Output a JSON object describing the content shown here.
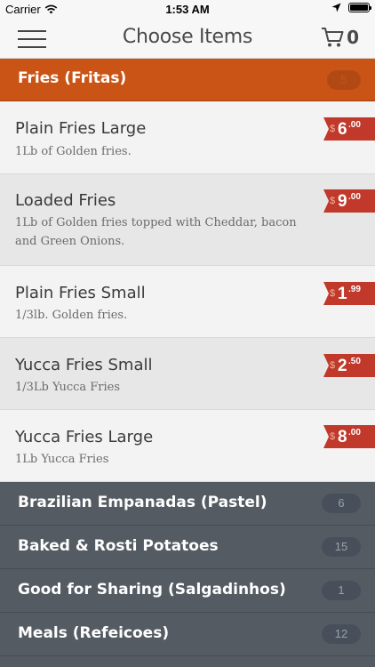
{
  "status_bar": {
    "carrier": "Carrier",
    "time": "1:53 AM",
    "icons": [
      "wifi-icon",
      "location-arrow-icon",
      "battery-icon"
    ]
  },
  "nav": {
    "title": "Choose Items",
    "cart_count": "0",
    "icons": [
      "hamburger-menu-icon",
      "cart-icon"
    ]
  },
  "active_category": {
    "name": "Fries (Fritas)",
    "count": "5"
  },
  "items": [
    {
      "name": "Plain Fries Large",
      "description": "1Lb of Golden fries.",
      "price_symbol": "$",
      "price_int": "6",
      "price_cents": ".00"
    },
    {
      "name": "Loaded Fries",
      "description": "1Lb of Golden fries topped with Cheddar, bacon and Green Onions.",
      "price_symbol": "$",
      "price_int": "9",
      "price_cents": ".00"
    },
    {
      "name": "Plain Fries Small",
      "description": "1/3lb. Golden fries.",
      "price_symbol": "$",
      "price_int": "1",
      "price_cents": ".99"
    },
    {
      "name": "Yucca Fries Small",
      "description": "1/3Lb Yucca Fries",
      "price_symbol": "$",
      "price_int": "2",
      "price_cents": ".50"
    },
    {
      "name": "Yucca Fries Large",
      "description": "1Lb Yucca Fries",
      "price_symbol": "$",
      "price_int": "8",
      "price_cents": ".00"
    }
  ],
  "categories": [
    {
      "name": "Brazilian Empanadas (Pastel)",
      "count": "6"
    },
    {
      "name": "Baked & Rosti Potatoes",
      "count": "15"
    },
    {
      "name": "Good for Sharing (Salgadinhos)",
      "count": "1"
    },
    {
      "name": "Meals (Refeicoes)",
      "count": "12"
    }
  ],
  "colors": {
    "accent_orange": "#c95416",
    "price_red": "#c0392b",
    "category_gray": "#545b62"
  }
}
